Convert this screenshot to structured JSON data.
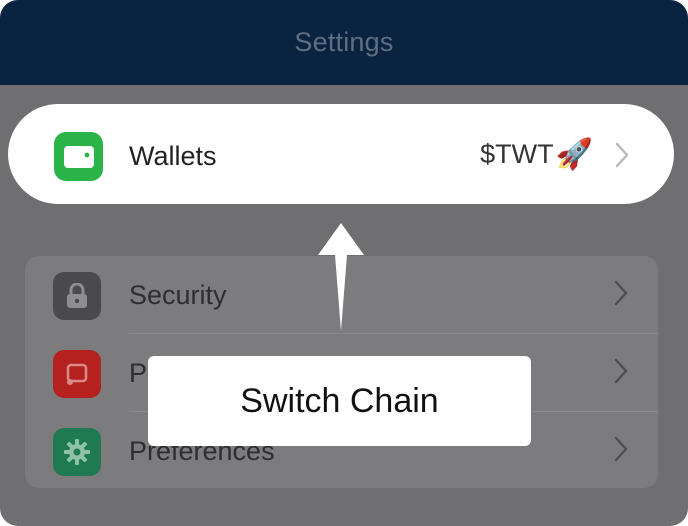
{
  "header": {
    "title": "Settings"
  },
  "wallet_row": {
    "label": "Wallets",
    "value": "$TWT",
    "value_emoji": "🚀",
    "icon": "wallet-icon",
    "icon_color": "#2bb44a"
  },
  "settings_group": {
    "items": [
      {
        "label": "Security",
        "icon": "lock-icon",
        "icon_color": "#4a4a4d"
      },
      {
        "label": "P",
        "icon": "push-notifications-icon",
        "icon_color": "#b5211e"
      },
      {
        "label": "Preferences",
        "icon": "gear-icon",
        "icon_color": "#1f7a52"
      }
    ]
  },
  "tooltip": {
    "text": "Switch Chain"
  },
  "colors": {
    "header_bg": "#0a2340",
    "overlay_bg": "#6f6f71",
    "highlight": "#ffffff"
  }
}
